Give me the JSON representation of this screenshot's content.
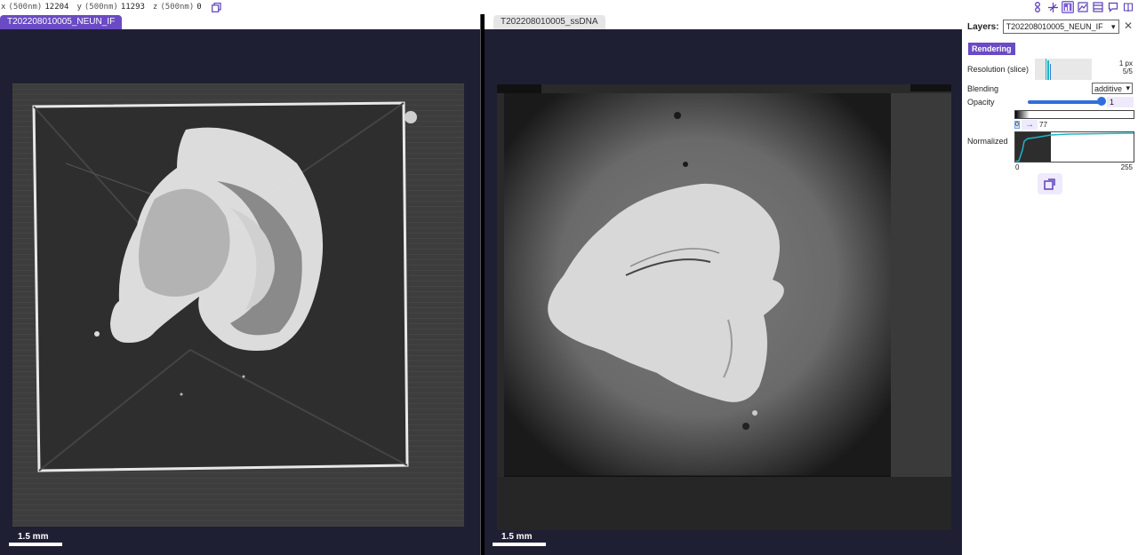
{
  "coords": {
    "x": {
      "axis": "x",
      "unit": "(500nm)",
      "value": "12204"
    },
    "y": {
      "axis": "y",
      "unit": "(500nm)",
      "value": "11293"
    },
    "z": {
      "axis": "z",
      "unit": "(500nm)",
      "value": "0"
    }
  },
  "toolbar_icons": [
    "two-panel-layout-icon",
    "axes-icon",
    "layer-panel-icon",
    "image-settings-icon",
    "selection-panel-icon",
    "annotation-icon",
    "help-icon"
  ],
  "viewers": {
    "left": {
      "tab_label": "T202208010005_NEUN_IF",
      "scale_label": "1.5 mm"
    },
    "right": {
      "tab_label": "T202208010005_ssDNA",
      "scale_label": "1.5 mm"
    }
  },
  "side_panel": {
    "layers_label": "Layers:",
    "layers_value": "T202208010005_NEUN_IF",
    "rendering_tab": "Rendering",
    "resolution_label": "Resolution (slice)",
    "resolution_px": "1 px",
    "resolution_level": "5/5",
    "blending_label": "Blending",
    "blending_value": "additive",
    "opacity_label": "Opacity",
    "opacity_value": "1",
    "range_min": "0",
    "range_max": "77",
    "normalized_label": "Normalized",
    "axis_min": "0",
    "axis_max": "255"
  },
  "colors": {
    "accent": "#6a4bc4",
    "slider": "#2f6fdd",
    "histogram": "#19b6c8",
    "viewer_bg": "#1f1f33"
  }
}
